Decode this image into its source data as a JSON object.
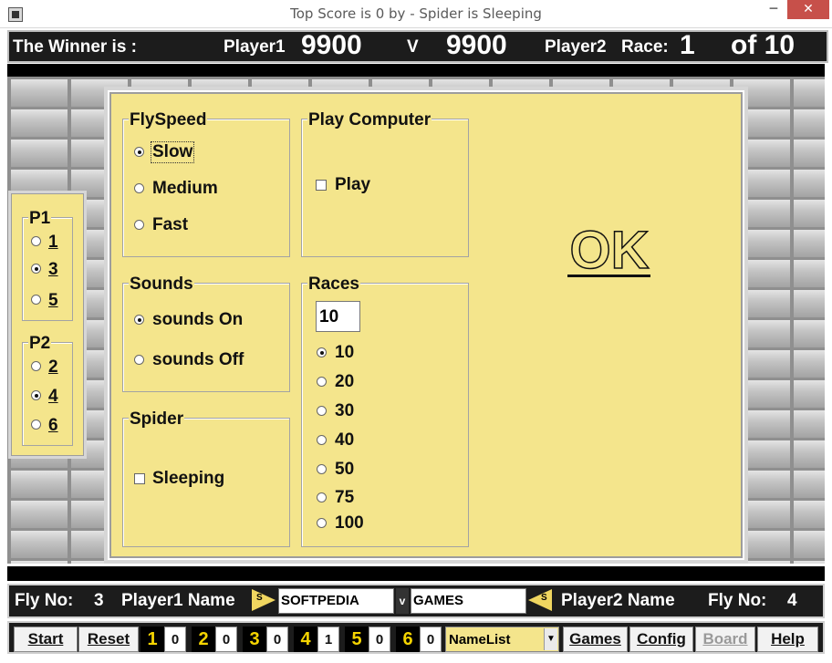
{
  "window": {
    "title": "Top Score is 0 by  - Spider is Sleeping",
    "min_glyph": "─",
    "max_glyph": "□",
    "close_glyph": "✕"
  },
  "scorebar": {
    "winner_label": "The Winner is :",
    "player1_label": "Player1",
    "player1_score": "9900",
    "vs": "V",
    "player2_score": "9900",
    "player2_label": "Player2",
    "race_label": "Race:",
    "race_current": "1",
    "race_of": "of 10"
  },
  "options": {
    "flyspeed": {
      "title": "FlySpeed",
      "items": [
        "Slow",
        "Medium",
        "Fast"
      ],
      "selected": "Slow"
    },
    "play_computer": {
      "title": "Play Computer",
      "check_label": "Play",
      "checked": false
    },
    "sounds": {
      "title": "Sounds",
      "items": [
        "sounds On",
        "sounds Off"
      ],
      "selected": "sounds On"
    },
    "races": {
      "title": "Races",
      "input_value": "10",
      "items": [
        "10",
        "20",
        "30",
        "40",
        "50",
        "75",
        "100"
      ],
      "selected": "10"
    },
    "spider": {
      "title": "Spider",
      "check_label": "Sleeping",
      "checked": false
    },
    "ok_label": "OK"
  },
  "side_panel": {
    "p1": {
      "title": "P1",
      "items": [
        "1",
        "3",
        "5"
      ],
      "selected": "3"
    },
    "p2": {
      "title": "P2",
      "items": [
        "2",
        "4",
        "6"
      ],
      "selected": "4"
    }
  },
  "namebar": {
    "fly_no_label_left": "Fly No:",
    "fly_no_left": "3",
    "player1_name_label": "Player1 Name",
    "s_badge": "S",
    "player1_name": "SOFTPEDIA",
    "v_badge": "v",
    "player2_name": "GAMES",
    "player2_name_label": "Player2 Name",
    "fly_no_label_right": "Fly No:",
    "fly_no_right": "4"
  },
  "toolbar": {
    "start": "Start",
    "reset": "Reset",
    "counters": [
      {
        "n": "1",
        "v": "0"
      },
      {
        "n": "2",
        "v": "0"
      },
      {
        "n": "3",
        "v": "0"
      },
      {
        "n": "4",
        "v": "1"
      },
      {
        "n": "5",
        "v": "0"
      },
      {
        "n": "6",
        "v": "0"
      }
    ],
    "namelist": "NameList",
    "games": "Games",
    "config": "Config",
    "board": "Board",
    "help": "Help"
  }
}
